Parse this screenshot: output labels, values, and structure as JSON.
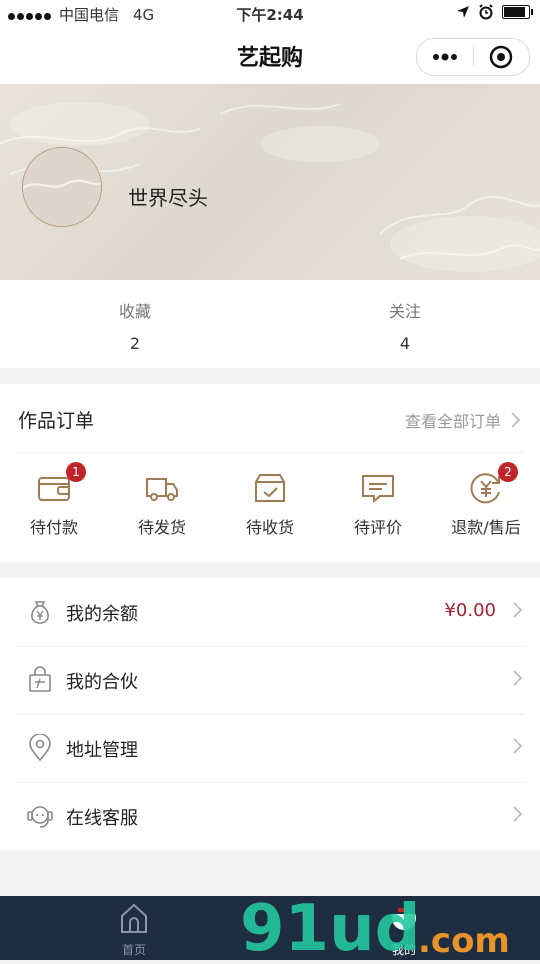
{
  "status_bar": {
    "carrier": "中国电信",
    "network": "4G",
    "time": "下午2:44",
    "battery_level": 0.8
  },
  "nav": {
    "title": "艺起购",
    "menu_icon": "more-dots-icon",
    "close_icon": "target-circle-icon"
  },
  "profile": {
    "username": "世界尽头"
  },
  "stats": [
    {
      "label": "收藏",
      "value": "2"
    },
    {
      "label": "关注",
      "value": "4"
    }
  ],
  "orders": {
    "title": "作品订单",
    "view_all": "查看全部订单",
    "items": [
      {
        "label": "待付款",
        "icon": "wallet-icon",
        "badge": "1"
      },
      {
        "label": "待发货",
        "icon": "truck-icon",
        "badge": ""
      },
      {
        "label": "待收货",
        "icon": "box-icon",
        "badge": ""
      },
      {
        "label": "待评价",
        "icon": "comment-icon",
        "badge": ""
      },
      {
        "label": "退款/售后",
        "icon": "refund-icon",
        "badge": "2"
      }
    ]
  },
  "menu": [
    {
      "label": "我的余额",
      "icon": "money-bag-icon",
      "value": "¥0.00"
    },
    {
      "label": "我的合伙",
      "icon": "shopping-bag-icon",
      "value": ""
    },
    {
      "label": "地址管理",
      "icon": "location-pin-icon",
      "value": ""
    },
    {
      "label": "在线客服",
      "icon": "headset-icon",
      "value": ""
    }
  ],
  "tabbar": {
    "home": {
      "label": "首页",
      "icon": "home-icon"
    },
    "me": {
      "label": "我的",
      "icon": "profile-icon"
    }
  },
  "watermark": {
    "text": "91ud",
    "suffix": ".com"
  },
  "colors": {
    "accent": "#9b2332",
    "badge": "#c0242b",
    "tabbar": "#1e2d40",
    "icon_brown": "#a07c55"
  }
}
